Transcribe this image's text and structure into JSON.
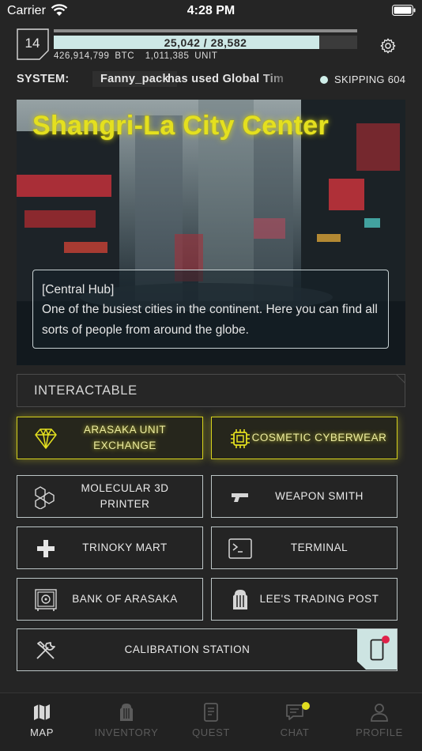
{
  "status_bar": {
    "carrier": "Carrier",
    "time": "4:28 PM"
  },
  "header": {
    "level": "14",
    "xp_text": "25,042 / 28,582",
    "xp_progress": 0.876,
    "btc": "426,914,799 BTC",
    "unit": "1,011,385 UNIT",
    "settings_icon": "gear-icon"
  },
  "ticker": {
    "system_label": "SYSTEM:",
    "user": "Fanny_pack",
    "message": "has used Global Tim",
    "skip_text": "SKIPPING 604"
  },
  "location": {
    "title": "Shangri-La City Center",
    "tag": "[Central Hub]",
    "description": "One of the busiest cities in the continent. Here you can find all sorts of people from around the globe."
  },
  "section_title": "INTERACTABLE",
  "actions": [
    {
      "label": "ARASAKA UNIT EXCHANGE",
      "icon": "diamond-icon",
      "highlighted": true
    },
    {
      "label": "COSMETIC CYBERWEAR",
      "icon": "chip-icon",
      "highlighted": true
    },
    {
      "label": "MOLECULAR 3D PRINTER",
      "icon": "hexagons-icon",
      "highlighted": false
    },
    {
      "label": "WEAPON SMITH",
      "icon": "gun-icon",
      "highlighted": false
    },
    {
      "label": "TRINOKY MART",
      "icon": "plus-icon",
      "highlighted": false
    },
    {
      "label": "TERMINAL",
      "icon": "terminal-icon",
      "highlighted": false
    },
    {
      "label": "BANK OF ARASAKA",
      "icon": "safe-icon",
      "highlighted": false
    },
    {
      "label": "LEE'S TRADING POST",
      "icon": "backpack-icon",
      "highlighted": false
    },
    {
      "label": "CALIBRATION STATION",
      "icon": "tools-icon",
      "highlighted": false
    }
  ],
  "tabs": [
    {
      "label": "MAP",
      "icon": "map-icon",
      "active": true
    },
    {
      "label": "INVENTORY",
      "icon": "backpack-icon",
      "active": false
    },
    {
      "label": "QUEST",
      "icon": "notebook-icon",
      "active": false
    },
    {
      "label": "CHAT",
      "icon": "chat-icon",
      "active": false
    },
    {
      "label": "PROFILE",
      "icon": "person-icon",
      "active": false
    }
  ],
  "colors": {
    "accent_yellow": "#e4e01f",
    "mint": "#cde8e6",
    "background": "#252525",
    "notification_red": "#e0224a"
  }
}
